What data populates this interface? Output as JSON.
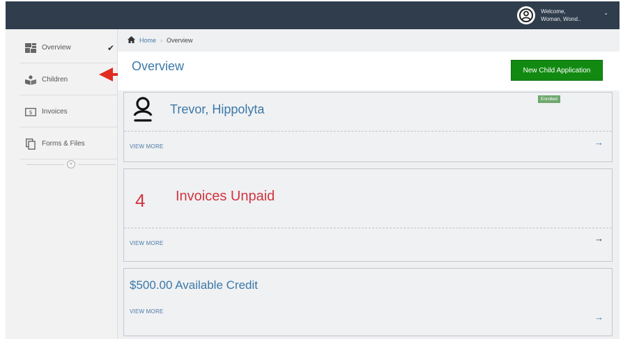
{
  "colors": {
    "topbar": "#2f3d4c",
    "accent": "#3b78a8",
    "primary_button": "#128a12",
    "danger": "#d0343e",
    "badge": "#6fa86f",
    "annotation_arrow": "#e02d20"
  },
  "user": {
    "welcome": "Welcome,",
    "name": "Woman, Wond..",
    "avatar_icon": "user-circle-icon",
    "caret_icon": "chevron-down-icon"
  },
  "sidebar": {
    "items": [
      {
        "label": "Overview",
        "icon": "grid-icon",
        "active": true
      },
      {
        "label": "Children",
        "icon": "children-icon"
      },
      {
        "label": "Invoices",
        "icon": "invoice-icon"
      },
      {
        "label": "Forms & Files",
        "icon": "files-icon"
      }
    ],
    "collapse_glyph": "«"
  },
  "breadcrumb": {
    "home": "Home",
    "separator": "›",
    "current": "Overview"
  },
  "page": {
    "title": "Overview",
    "new_child_button": "New Child Application"
  },
  "cards": {
    "child": {
      "name": "Trevor, Hippolyta",
      "status": "Enrolled",
      "view_more": "VIEW MORE",
      "arrow": "→"
    },
    "invoices": {
      "count": "4",
      "label": "Invoices Unpaid",
      "view_more": "VIEW MORE",
      "arrow": "→"
    },
    "credit": {
      "text": "$500.00 Available Credit",
      "view_more": "VIEW MORE",
      "arrow": "→"
    }
  }
}
